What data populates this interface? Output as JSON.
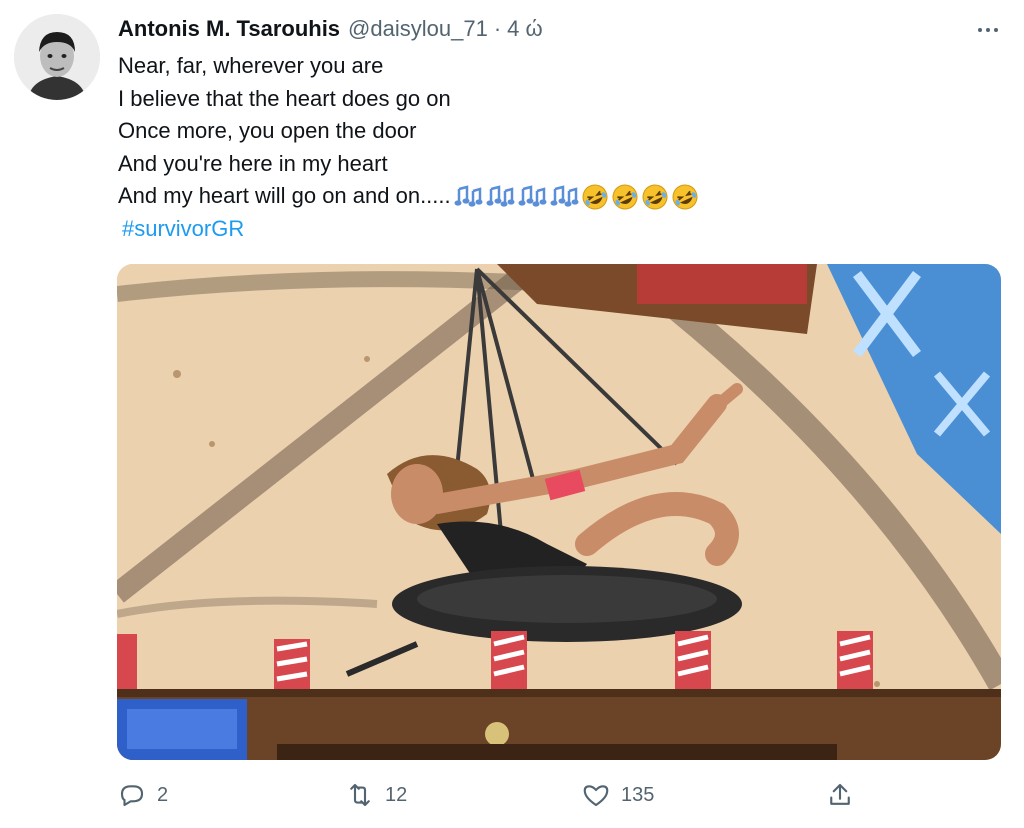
{
  "author": {
    "display_name": "Antonis M. Tsarouhis",
    "handle": "@daisylou_71",
    "separator": "·",
    "time": "4 ώ"
  },
  "tweet": {
    "lines": [
      "Near, far, wherever you are",
      "I believe that the heart does go on",
      "Once more, you open the door",
      "And you're here in my heart",
      "And my heart will go on and on....."
    ],
    "emojis": [
      "musical-notes",
      "musical-notes",
      "musical-notes",
      "musical-notes",
      "rolling-laughing",
      "rolling-laughing",
      "rolling-laughing",
      "rolling-laughing"
    ],
    "hashtag": "#survivorGR"
  },
  "icons": {
    "more": "more-horizontal-icon",
    "reply": "reply-icon",
    "retweet": "retweet-icon",
    "like": "like-icon",
    "share": "share-icon"
  },
  "actions": {
    "reply_count": "2",
    "retweet_count": "12",
    "like_count": "135"
  },
  "colors": {
    "text": "#0f1419",
    "secondary": "#536471",
    "link": "#1d9bf0"
  }
}
